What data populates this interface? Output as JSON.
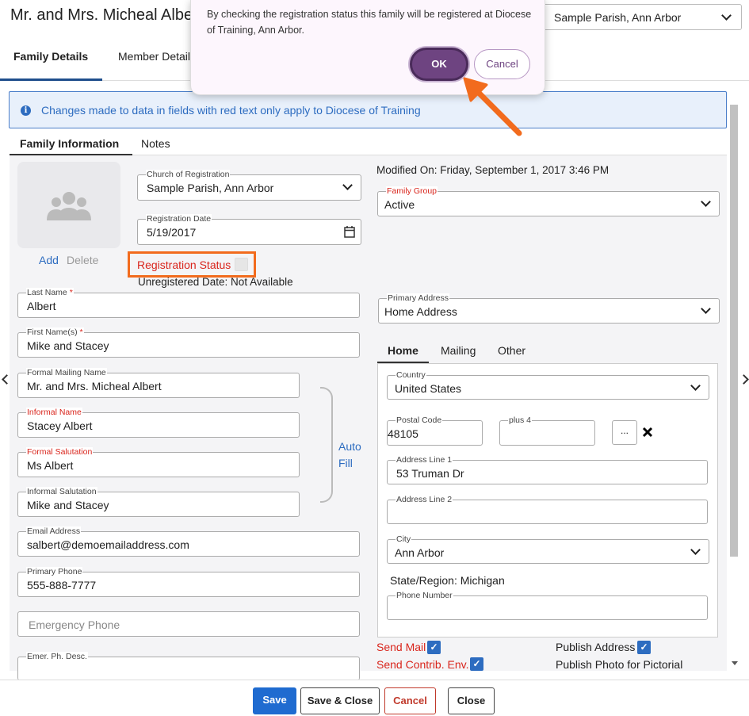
{
  "header": {
    "title": "Mr. and Mrs. Micheal Albert",
    "church_select_value": "Sample Parish, Ann Arbor"
  },
  "main_tabs": [
    {
      "label": "Family Details"
    },
    {
      "label": "Member Details"
    }
  ],
  "info_banner": {
    "icon": "info-icon",
    "text": "Changes made to data in fields with red text only apply to Diocese of Training"
  },
  "sub_tabs": [
    {
      "label": "Family Information"
    },
    {
      "label": "Notes"
    }
  ],
  "photo": {
    "icon": "people-group-icon",
    "add_label": "Add",
    "delete_label": "Delete"
  },
  "church": {
    "label": "Church of Registration",
    "value": "Sample Parish, Ann Arbor"
  },
  "registration_date": {
    "label": "Registration Date",
    "value": "5/19/2017"
  },
  "registration_status": {
    "label": "Registration Status",
    "checked": false
  },
  "unregistered_date": "Unregistered Date: Not Available",
  "modified_on": "Modified On: Friday, September 1, 2017 3:46 PM",
  "family_group": {
    "label": "Family Group",
    "value": "Active"
  },
  "last_name": {
    "label": "Last Name",
    "required_mark": "*",
    "value": "Albert"
  },
  "first_names": {
    "label": "First Name(s)",
    "required_mark": "*",
    "value": "Mike and Stacey"
  },
  "formal_mailing_name": {
    "label": "Formal Mailing Name",
    "value": "Mr. and Mrs. Micheal Albert"
  },
  "informal_name": {
    "label": "Informal Name",
    "value": "Stacey Albert"
  },
  "formal_salutation": {
    "label": "Formal Salutation",
    "value": "Ms Albert"
  },
  "informal_salutation": {
    "label": "Informal Salutation",
    "value": "Mike and Stacey"
  },
  "auto_fill": {
    "line1": "Auto",
    "line2": "Fill"
  },
  "email": {
    "label": "Email Address",
    "value": "salbert@demoemailaddress.com"
  },
  "primary_phone": {
    "label": "Primary Phone",
    "value": "555-888-7777"
  },
  "emergency_phone": {
    "placeholder": "Emergency Phone"
  },
  "emer_ph_desc": {
    "label": "Emer. Ph. Desc.",
    "value": ""
  },
  "primary_address": {
    "label": "Primary Address",
    "value": "Home Address"
  },
  "address_tabs": [
    {
      "label": "Home"
    },
    {
      "label": "Mailing"
    },
    {
      "label": "Other"
    }
  ],
  "address": {
    "country": {
      "label": "Country",
      "value": "United States"
    },
    "postal_code": {
      "label": "Postal Code",
      "value": "48105"
    },
    "plus4": {
      "label": "plus 4",
      "value": ""
    },
    "lookup_button": "...",
    "clear_icon": "close-x-icon",
    "line1": {
      "label": "Address Line 1",
      "value": "53 Truman Dr"
    },
    "line2": {
      "label": "Address Line 2",
      "value": ""
    },
    "city": {
      "label": "City",
      "value": "Ann Arbor"
    },
    "state_region": "State/Region: Michigan",
    "phone": {
      "label": "Phone Number",
      "value": ""
    }
  },
  "flags": {
    "send_mail": {
      "label": "Send Mail",
      "checked": true
    },
    "send_contrib_env": {
      "label": "Send Contrib. Env.",
      "checked": true
    },
    "publish_address": {
      "label": "Publish Address",
      "checked": true
    },
    "publish_photo": {
      "label": "Publish Photo for Pictorial"
    }
  },
  "footer": {
    "save": "Save",
    "save_close": "Save & Close",
    "cancel": "Cancel",
    "close": "Close"
  },
  "modal": {
    "message": "By checking the registration status this family will be registered at Diocese of Training, Ann Arbor.",
    "ok": "OK",
    "cancel": "Cancel"
  },
  "colors": {
    "accent_blue": "#2d6cc0",
    "required_red": "#d9251c",
    "modal_purple": "#6e4481",
    "highlight_orange": "#f26b1d"
  }
}
